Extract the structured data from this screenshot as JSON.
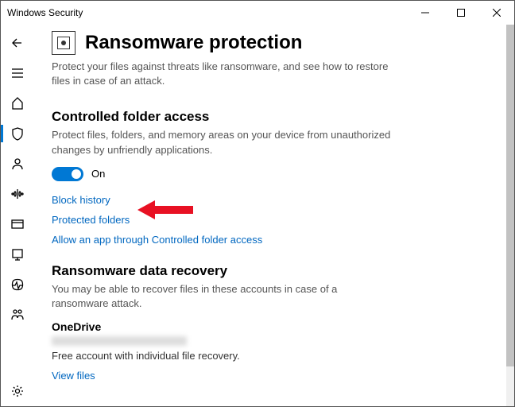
{
  "window": {
    "title": "Windows Security"
  },
  "page": {
    "title": "Ransomware protection",
    "description": "Protect your files against threats like ransomware, and see how to restore files in case of an attack."
  },
  "cfa": {
    "heading": "Controlled folder access",
    "description": "Protect files, folders, and memory areas on your device from unauthorized changes by unfriendly applications.",
    "toggle_state": "On",
    "link_block_history": "Block history",
    "link_protected_folders": "Protected folders",
    "link_allow_app": "Allow an app through Controlled folder access"
  },
  "recovery": {
    "heading": "Ransomware data recovery",
    "description": "You may be able to recover files in these accounts in case of a ransomware attack.",
    "onedrive_title": "OneDrive",
    "onedrive_desc": "Free account with individual file recovery.",
    "view_files": "View files"
  }
}
